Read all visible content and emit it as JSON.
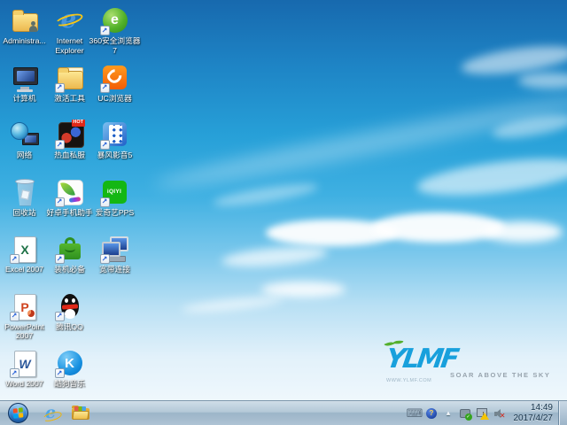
{
  "colors": {
    "sky_top": "#1769ae",
    "sky_mid": "#27a0d8",
    "sky_bottom": "#f6fbfe",
    "taskbar_light": "#cfdde8",
    "taskbar_dark": "#9cb5c8",
    "logo_blue": "#18a0dc",
    "logo_green": "#55b02e",
    "icon_label_text": "#ffffff",
    "clock_text": "#17334a",
    "hot_badge": "#e02818"
  },
  "desktop": {
    "shortcut_arrow_glyph": "↗",
    "icons": [
      {
        "name": "administrator-folder",
        "label": "Administra..."
      },
      {
        "name": "computer",
        "label": "计算机"
      },
      {
        "name": "network",
        "label": "网络"
      },
      {
        "name": "recycle-bin",
        "label": "回收站"
      },
      {
        "name": "excel-2007",
        "label": "Excel 2007",
        "glyph": "X"
      },
      {
        "name": "powerpoint-2007",
        "label": "PowerPoint 2007",
        "glyph": "P"
      },
      {
        "name": "word-2007",
        "label": "Word 2007",
        "glyph": "W"
      },
      {
        "name": "internet-explorer",
        "label": "Internet Explorer",
        "glyph": "e"
      },
      {
        "name": "activation-tools",
        "label": "激活工具"
      },
      {
        "name": "rexue-sifu-game",
        "label": "热血私服",
        "badge": "HOT"
      },
      {
        "name": "haozhuo-phone-assistant",
        "label": "好卓手机助手"
      },
      {
        "name": "zhuangji-bibei",
        "label": "装机必备"
      },
      {
        "name": "tencent-qq",
        "label": "腾讯QQ"
      },
      {
        "name": "kugou-music",
        "label": "酷狗音乐",
        "glyph": "K"
      },
      {
        "name": "360-safe-browser",
        "label": "360安全浏览器7",
        "glyph": "e"
      },
      {
        "name": "uc-browser",
        "label": "UC浏览器"
      },
      {
        "name": "baofeng-player-5",
        "label": "暴风影音5"
      },
      {
        "name": "iqiyi-pps",
        "label": "爱奇艺PPS",
        "glyph": "iQIYI"
      },
      {
        "name": "broadband-connection",
        "label": "宽带连接"
      }
    ]
  },
  "logo": {
    "brand": "YLMF",
    "tagline": "SOAR ABOVE THE SKY",
    "url": "WWW.YLMF.COM"
  },
  "taskbar": {
    "pinned": [
      {
        "name": "internet-explorer",
        "glyph": "e"
      },
      {
        "name": "windows-explorer"
      }
    ],
    "tray": {
      "keyboard_glyph": "⌨",
      "help_glyph": "?",
      "expand_glyph": "▴",
      "check_glyph": "✓",
      "warning_glyph": "!",
      "mute_glyph": "✕"
    },
    "clock": {
      "time": "14:49",
      "date": "2017/4/27"
    }
  }
}
